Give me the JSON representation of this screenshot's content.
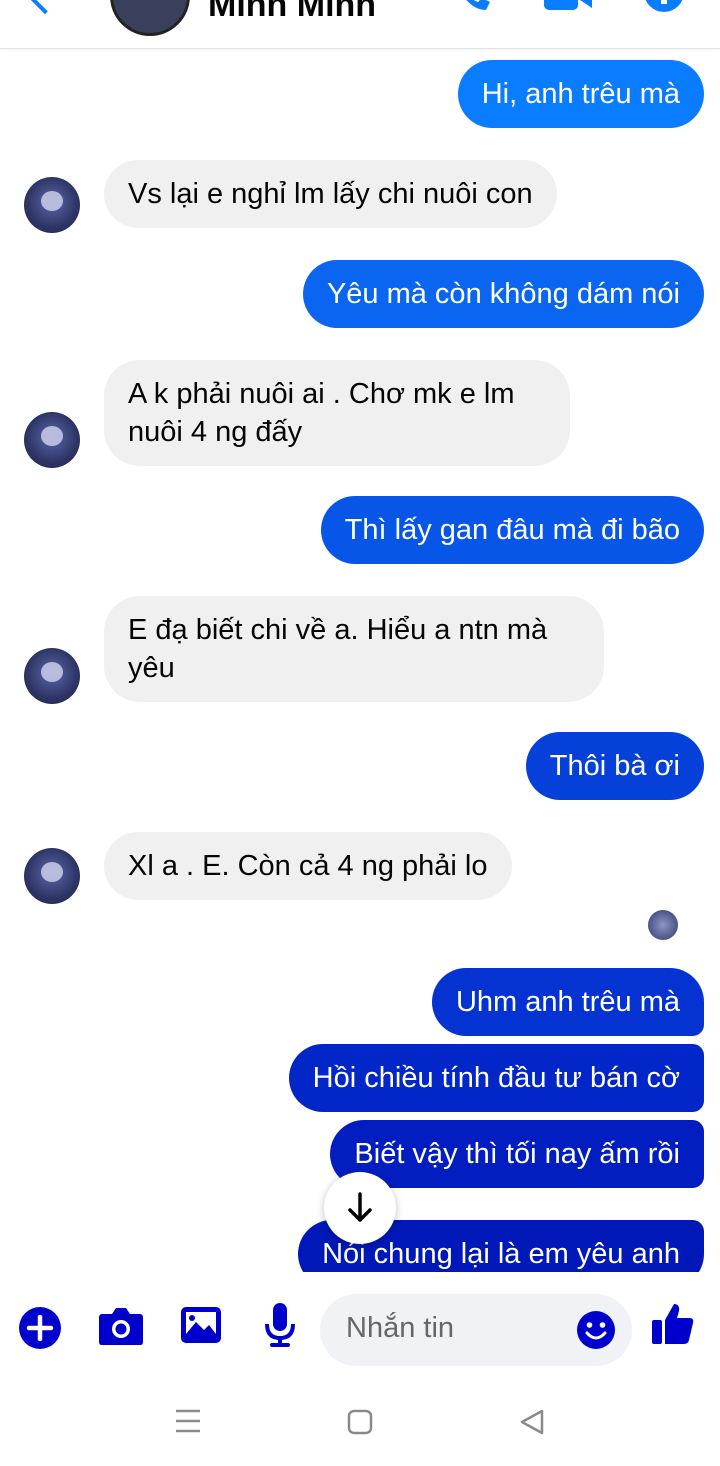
{
  "header": {
    "contact_name": "Minh Minh",
    "icons": [
      "back-arrow-icon",
      "phone-icon",
      "video-camera-icon",
      "info-icon"
    ]
  },
  "messages": [
    {
      "from": "me",
      "text": "Hi, anh trêu mà"
    },
    {
      "from": "them",
      "text": "Vs lại e nghỉ lm lấy chi nuôi con"
    },
    {
      "from": "me",
      "text": "Yêu mà còn không dám nói"
    },
    {
      "from": "them",
      "lines": [
        "A k phải nuôi ai . Chơ mk e lm",
        "nuôi 4 ng đấy"
      ]
    },
    {
      "from": "me",
      "text": "Thì lấy gan đâu mà đi bão"
    },
    {
      "from": "them",
      "lines": [
        "E đạ biết chi về a. Hiểu a ntn mà",
        "yêu"
      ]
    },
    {
      "from": "me",
      "text": "Thôi bà ơi"
    },
    {
      "from": "them",
      "text": "Xl a . E. Còn cả 4 ng phải lo"
    },
    {
      "from": "me",
      "text": "Uhm anh trêu mà"
    },
    {
      "from": "me",
      "text": "Hồi chiều tính đầu tư bán cờ"
    },
    {
      "from": "me",
      "text": "Biết vậy thì tối nay ấm rồi"
    },
    {
      "from": "me",
      "text": "Nói chung lại là em yêu anh"
    }
  ],
  "composer": {
    "placeholder": "Nhắn tin",
    "icons": [
      "plus-icon",
      "camera-icon",
      "gallery-icon",
      "microphone-icon",
      "emoji-icon",
      "like-icon"
    ]
  },
  "colors": {
    "accent": "#0a7cff",
    "bubble_in": "#f0f0f0",
    "composer_icon": "#0000cc"
  }
}
